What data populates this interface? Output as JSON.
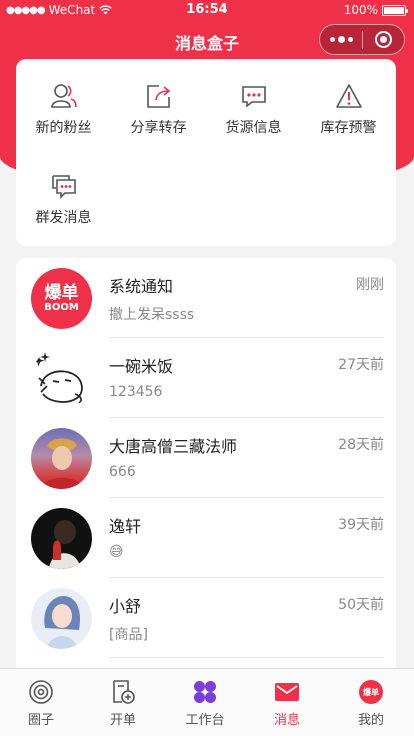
{
  "status_bar": {
    "carrier": "WeChat",
    "time": "16:54",
    "battery": "100%"
  },
  "nav": {
    "title": "消息盒子"
  },
  "functions": [
    {
      "label": "新的粉丝",
      "icon": "new-fans-icon"
    },
    {
      "label": "分享转存",
      "icon": "share-icon"
    },
    {
      "label": "货源信息",
      "icon": "supply-message-icon"
    },
    {
      "label": "库存预警",
      "icon": "warning-icon"
    },
    {
      "label": "群发消息",
      "icon": "group-message-icon"
    }
  ],
  "messages": [
    {
      "name": "系统通知",
      "time": "刚刚",
      "preview": "撤上发呆ssss",
      "avatar_text": "爆单",
      "avatar_sub": "BOOM"
    },
    {
      "name": "一碗米饭",
      "time": "27天前",
      "preview": "123456"
    },
    {
      "name": "大唐高僧三藏法师",
      "time": "28天前",
      "preview": "666"
    },
    {
      "name": "逸轩",
      "time": "39天前",
      "preview": "😅"
    },
    {
      "name": "小舒",
      "time": "50天前",
      "preview": "[商品]"
    }
  ],
  "tabs": [
    {
      "label": "圈子",
      "icon": "circle-icon"
    },
    {
      "label": "开单",
      "icon": "order-icon"
    },
    {
      "label": "工作台",
      "icon": "workbench-icon"
    },
    {
      "label": "消息",
      "icon": "message-icon",
      "active": true
    },
    {
      "label": "我的",
      "icon": "profile-icon"
    }
  ],
  "colors": {
    "brand": "#ee3148",
    "workbench": "#7b3fd8"
  }
}
